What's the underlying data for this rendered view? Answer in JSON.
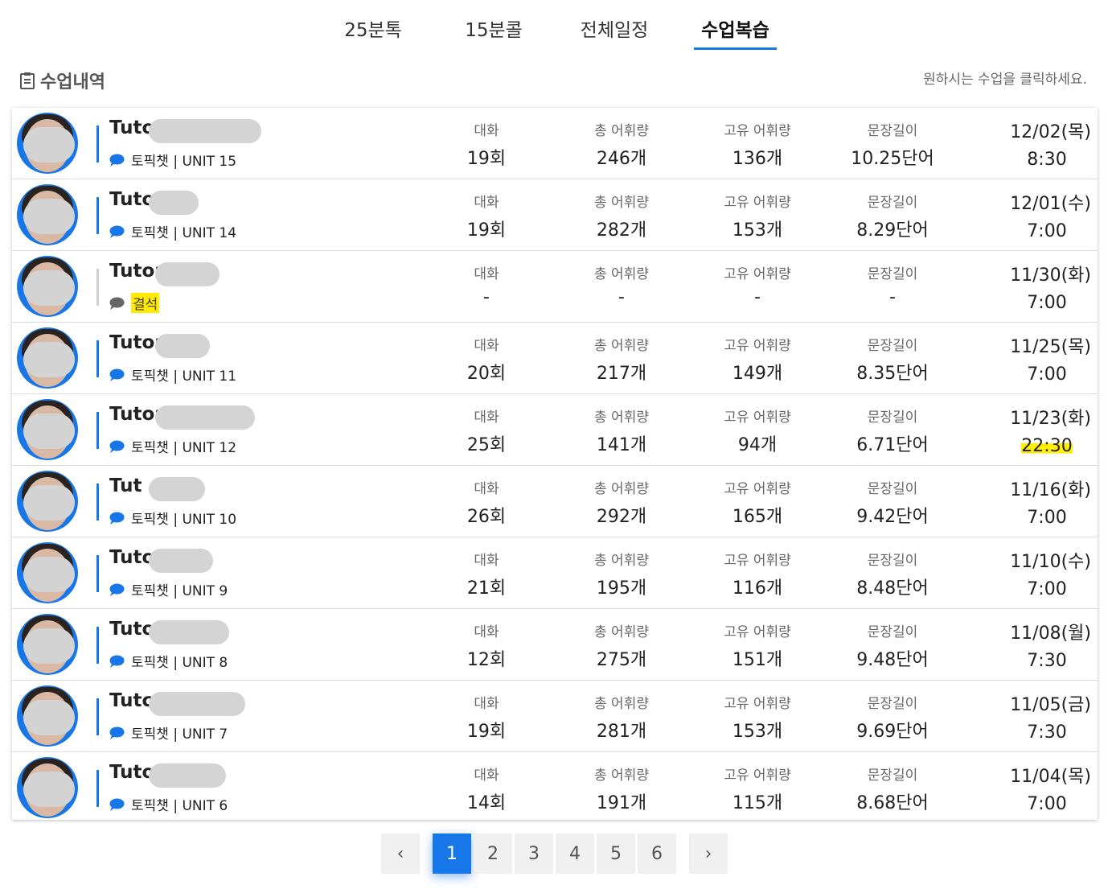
{
  "tabs": [
    {
      "label": "25분톡",
      "active": false
    },
    {
      "label": "15분콜",
      "active": false
    },
    {
      "label": "전체일정",
      "active": false
    },
    {
      "label": "수업복습",
      "active": true
    }
  ],
  "section": {
    "title": "수업내역",
    "hint": "원하시는 수업을 클릭하세요."
  },
  "labels": {
    "talk": "대화",
    "total_vocab": "총 어휘량",
    "unique_vocab": "고유 어휘량",
    "sentence_len": "문장길이"
  },
  "lessons": [
    {
      "tutor": "Tuto",
      "course": "토픽챗 | UNIT 15",
      "talk": "19회",
      "total": "246개",
      "unique": "136개",
      "length": "10.25단어",
      "date": "12/02(목)",
      "time": "8:30",
      "absent": false,
      "highlight_time": false
    },
    {
      "tutor": "Tuto",
      "course": "토픽챗 | UNIT 14",
      "talk": "19회",
      "total": "282개",
      "unique": "153개",
      "length": "8.29단어",
      "date": "12/01(수)",
      "time": "7:00",
      "absent": false,
      "highlight_time": false
    },
    {
      "tutor": "Tutor",
      "course": "결석",
      "talk": "-",
      "total": "-",
      "unique": "-",
      "length": "-",
      "date": "11/30(화)",
      "time": "7:00",
      "absent": true,
      "highlight_time": false
    },
    {
      "tutor": "Tutor",
      "course": "토픽챗 | UNIT 11",
      "talk": "20회",
      "total": "217개",
      "unique": "149개",
      "length": "8.35단어",
      "date": "11/25(목)",
      "time": "7:00",
      "absent": false,
      "highlight_time": false
    },
    {
      "tutor": "Tutor",
      "course": "토픽챗 | UNIT 12",
      "talk": "25회",
      "total": "141개",
      "unique": "94개",
      "length": "6.71단어",
      "date": "11/23(화)",
      "time": "22:30",
      "absent": false,
      "highlight_time": true
    },
    {
      "tutor": "Tut",
      "course": "토픽챗 | UNIT 10",
      "talk": "26회",
      "total": "292개",
      "unique": "165개",
      "length": "9.42단어",
      "date": "11/16(화)",
      "time": "7:00",
      "absent": false,
      "highlight_time": false
    },
    {
      "tutor": "Tuto",
      "course": "토픽챗 | UNIT 9",
      "talk": "21회",
      "total": "195개",
      "unique": "116개",
      "length": "8.48단어",
      "date": "11/10(수)",
      "time": "7:00",
      "absent": false,
      "highlight_time": false
    },
    {
      "tutor": "Tuto",
      "course": "토픽챗 | UNIT 8",
      "talk": "12회",
      "total": "275개",
      "unique": "151개",
      "length": "9.48단어",
      "date": "11/08(월)",
      "time": "7:30",
      "absent": false,
      "highlight_time": false
    },
    {
      "tutor": "Tutc",
      "course": "토픽챗 | UNIT 7",
      "talk": "19회",
      "total": "281개",
      "unique": "153개",
      "length": "9.69단어",
      "date": "11/05(금)",
      "time": "7:30",
      "absent": false,
      "highlight_time": false
    },
    {
      "tutor": "Tuto",
      "course": "토픽챗 | UNIT 6",
      "talk": "14회",
      "total": "191개",
      "unique": "115개",
      "length": "8.68단어",
      "date": "11/04(목)",
      "time": "7:00",
      "absent": false,
      "highlight_time": false
    }
  ],
  "pager": {
    "prev": "‹",
    "pages": [
      "1",
      "2",
      "3",
      "4",
      "5",
      "6"
    ],
    "active": "1",
    "next": "›"
  },
  "colors": {
    "accent": "#1877e8",
    "highlight": "#ffee00"
  }
}
